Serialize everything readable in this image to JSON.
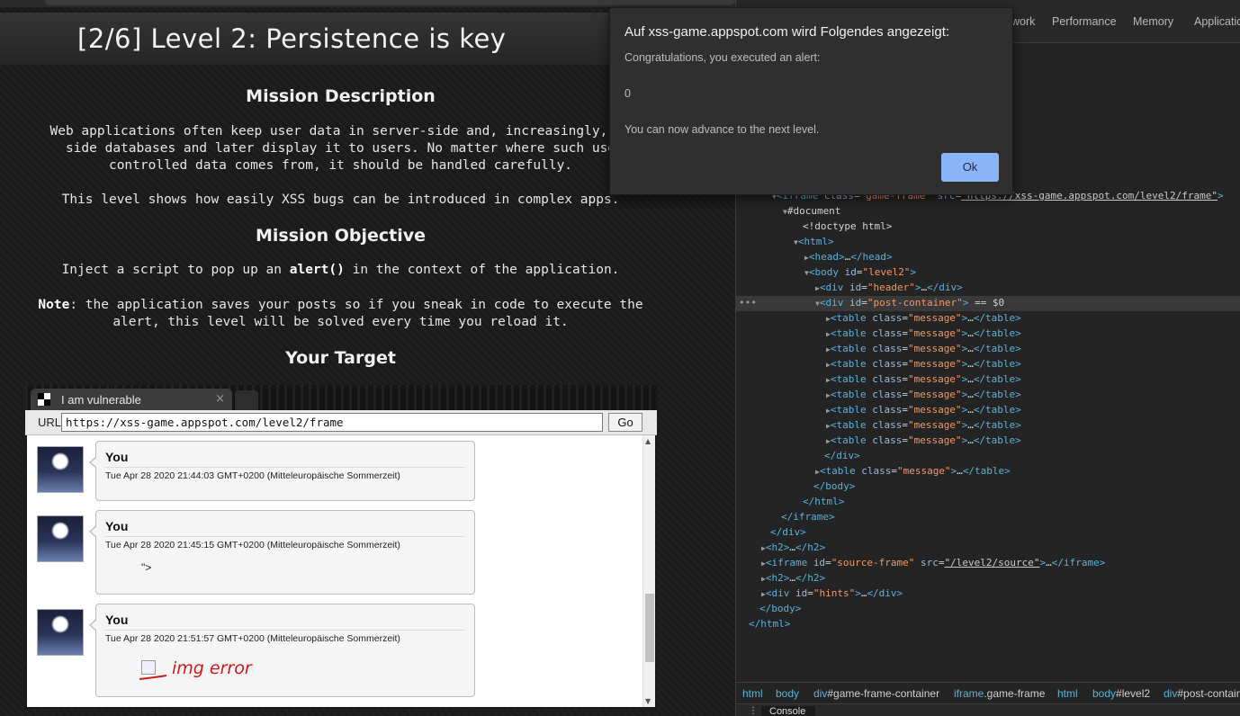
{
  "game": {
    "title": "[2/6]  Level 2: Persistence is key",
    "mission_heading": "Mission Description",
    "mission_p1_l1": "Web applications often keep user data in server-side and, increasingly, cl",
    "mission_p1_l2": "side databases and later display it to users. No matter where such use",
    "mission_p1_l3": "controlled data comes from, it should be handled carefully.",
    "mission_p2": "This level shows how easily XSS bugs can be introduced in complex apps.",
    "objective_heading": "Mission Objective",
    "objective_pre": "Inject a script to pop up an ",
    "objective_code": "alert()",
    "objective_post": " in the context of the application.",
    "note_label": "Note",
    "note_l1": ": the application saves your posts so if you sneak in code to execute the",
    "note_l2": "alert, this level will be solved every time you reload it.",
    "target_heading": "Your Target"
  },
  "target_browser": {
    "tab_title": "I am vulnerable",
    "tab_close": "×",
    "url_label": "URL",
    "url": "https://xss-game.appspot.com/level2/frame",
    "go_label": "Go",
    "posts": [
      {
        "author": "You",
        "date": "Tue Apr 28 2020 21:44:03 GMT+0200 (Mitteleuropäische Sommerzeit)",
        "body": ""
      },
      {
        "author": "You",
        "date": "Tue Apr 28 2020 21:45:15 GMT+0200 (Mitteleuropäische Sommerzeit)",
        "body": "\">"
      },
      {
        "author": "You",
        "date": "Tue Apr 28 2020 21:51:57 GMT+0200 (Mitteleuropäische Sommerzeit)",
        "body": "",
        "annotation": "img error"
      }
    ]
  },
  "devtools": {
    "tabs": [
      "work",
      "Performance",
      "Memory",
      "Applicatio"
    ],
    "selected_suffix": "== $0",
    "breadcrumbs": [
      {
        "tag": "html",
        "rest": ""
      },
      {
        "tag": "body",
        "rest": ""
      },
      {
        "tag": "div",
        "rest": "#game-frame-container"
      },
      {
        "tag": "iframe",
        "rest": ".game-frame"
      },
      {
        "tag": "html",
        "rest": ""
      },
      {
        "tag": "body",
        "rest": "#level2"
      },
      {
        "tag": "div",
        "rest": "#post-contain"
      }
    ],
    "drawer_tab": "Console"
  },
  "alert": {
    "title": "Auf xss-game.appspot.com wird Folgendes angezeigt:",
    "line1": "Congratulations, you executed an alert:",
    "line2": "0",
    "line3": "You can now advance to the next level.",
    "ok_label": "Ok"
  },
  "colors": {
    "accent_button": "#8ab4f8",
    "tag": "#5db0d7",
    "attr_value": "#f29766",
    "annotation": "#d11a1a"
  }
}
